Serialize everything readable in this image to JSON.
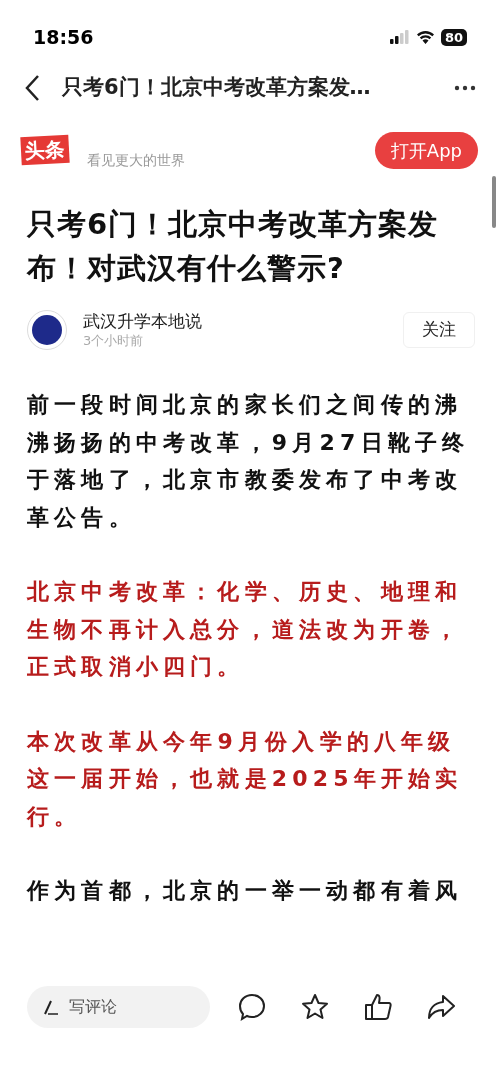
{
  "status_bar": {
    "time": "18:56",
    "battery": "80"
  },
  "nav": {
    "title": "只考6门！北京中考改革方案发…"
  },
  "banner": {
    "logo": "头条",
    "slogan": "看见更大的世界",
    "open_button": "打开App"
  },
  "article": {
    "title": "只考6门！北京中考改革方案发布！对武汉有什么警示?",
    "author": {
      "name": "武汉升学本地说",
      "time": "3个小时前",
      "follow": "关注"
    },
    "paragraphs": [
      {
        "text": "前一段时间北京的家长们之间传的沸沸扬扬的中考改革，9月27日靴子终于落地了，北京市教委发布了中考改革公告。",
        "highlight": false
      },
      {
        "text": "北京中考改革：化学、历史、地理和生物不再计入总分，道法改为开卷，正式取消小四门。",
        "highlight": true
      },
      {
        "text": "本次改革从今年9月份入学的八年级这一届开始，也就是2025年开始实行。",
        "highlight": true
      },
      {
        "text": "作为首都，北京的一举一动都有着风",
        "highlight": false
      }
    ]
  },
  "bottom_bar": {
    "comment_placeholder": "写评论"
  }
}
